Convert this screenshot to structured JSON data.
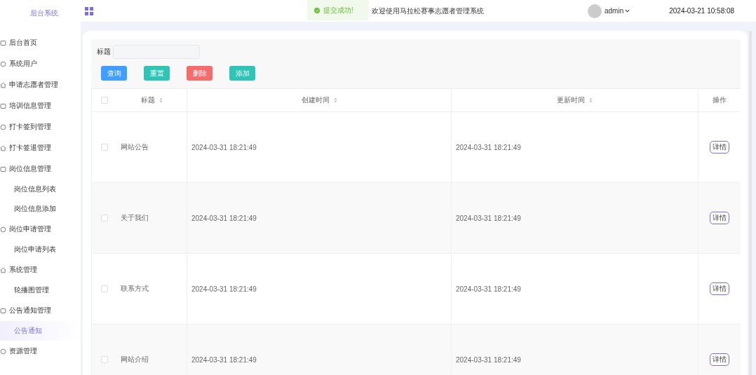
{
  "sidebar": {
    "title": "后台系统",
    "items": [
      {
        "label": "后台首页",
        "selected": false
      },
      {
        "label": "系统用户",
        "selected": false
      },
      {
        "label": "申请志愿者管理",
        "selected": false
      },
      {
        "label": "培训信息管理",
        "selected": false
      },
      {
        "label": "打卡签到管理",
        "selected": false
      },
      {
        "label": "打卡签退管理",
        "selected": false
      },
      {
        "label": "岗位信息管理",
        "selected": false,
        "children": [
          {
            "label": "岗位信息列表",
            "selected": false
          },
          {
            "label": "岗位信息添加",
            "selected": false
          }
        ]
      },
      {
        "label": "岗位申请管理",
        "selected": false,
        "children": [
          {
            "label": "岗位申请列表",
            "selected": false
          }
        ]
      },
      {
        "label": "系统管理",
        "selected": false,
        "children": [
          {
            "label": "轮播图管理",
            "selected": false
          }
        ]
      },
      {
        "label": "公告通知管理",
        "selected": false,
        "children": [
          {
            "label": "公告通知",
            "selected": true
          }
        ]
      },
      {
        "label": "资源管理",
        "selected": false
      }
    ]
  },
  "header": {
    "toast": "提交成功!",
    "welcome": "欢迎使用马拉松赛事志愿者管理系统",
    "user": "admin",
    "datetime": "2024-03-21 10:58:08"
  },
  "search": {
    "label": "标题"
  },
  "buttons": [
    {
      "label": "查询",
      "color": "#409eff"
    },
    {
      "label": "重置",
      "color": "#2ec4b6"
    },
    {
      "label": "删除",
      "color": "#f56c6c"
    },
    {
      "label": "添加",
      "color": "#2ec4b6"
    }
  ],
  "table": {
    "header_checked": false,
    "columns": [
      {
        "label": "标题",
        "kind": "sortable"
      },
      {
        "label": "创建时间",
        "kind": "sortable"
      },
      {
        "label": "更新时间",
        "kind": "sortable"
      },
      {
        "label": "操作",
        "kind": "action"
      }
    ],
    "rows": [
      {
        "checked": false,
        "title": "网站公告",
        "created": "2024-03-31 18:21:49",
        "updated": "2024-03-31 18:21:49",
        "action": "详情"
      },
      {
        "checked": false,
        "title": "关于我们",
        "created": "2024-03-31 18:21:49",
        "updated": "2024-03-31 18:21:49",
        "action": "详情"
      },
      {
        "checked": false,
        "title": "联系方式",
        "created": "2024-03-31 18:21:49",
        "updated": "2024-03-31 18:21:49",
        "action": "详情"
      },
      {
        "checked": false,
        "title": "网站介绍",
        "created": "2024-03-31 18:21:49",
        "updated": "2024-03-31 18:21:49",
        "action": "详情"
      }
    ]
  }
}
